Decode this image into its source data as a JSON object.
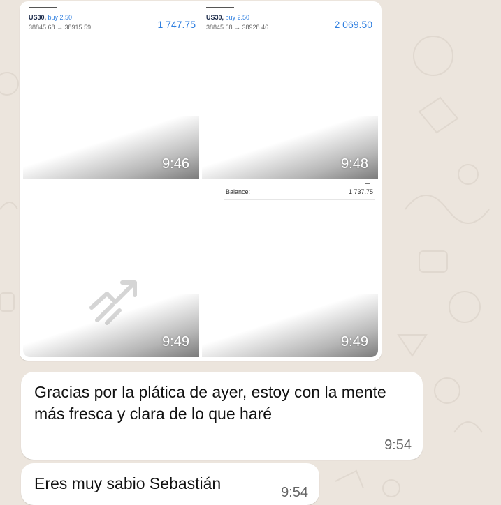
{
  "album": {
    "tiles": [
      {
        "symbol": "US30,",
        "side": "buy 2.50",
        "prices": "38845.68 → 38915.59",
        "profit": "1 747.75",
        "time": "9:46"
      },
      {
        "symbol": "US30,",
        "side": "buy 2.50",
        "prices": "38845.68 → 38928.46",
        "profit": "2 069.50",
        "time": "9:48"
      },
      {
        "time": "9:49",
        "icon": "trending-up-icon"
      },
      {
        "balance_label": "Balance:",
        "balance_value": "1 737.75",
        "time": "9:49"
      }
    ]
  },
  "messages": [
    {
      "text": "Gracias por la plática de ayer, estoy con la mente más fresca y clara de lo que haré",
      "time": "9:54"
    },
    {
      "text": "Eres muy sabio Sebastián",
      "time": "9:54"
    }
  ],
  "colors": {
    "chat_background": "#ece5dd",
    "bubble": "#ffffff",
    "accent_blue": "#2f7fe0"
  }
}
